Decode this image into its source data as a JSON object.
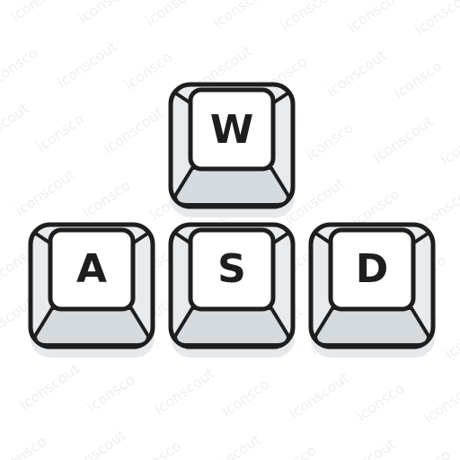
{
  "watermark_text": "iconscout",
  "keys": [
    {
      "id": "w",
      "label": "W"
    },
    {
      "id": "a",
      "label": "A"
    },
    {
      "id": "s",
      "label": "S"
    },
    {
      "id": "d",
      "label": "D"
    }
  ],
  "colors": {
    "outline": "#1e1e1e",
    "key_face": "#ffffff",
    "key_side": "#e8ebed",
    "key_bottom": "#d4dade",
    "shadow": "#e6e9ec",
    "watermark": "#eceff1"
  }
}
